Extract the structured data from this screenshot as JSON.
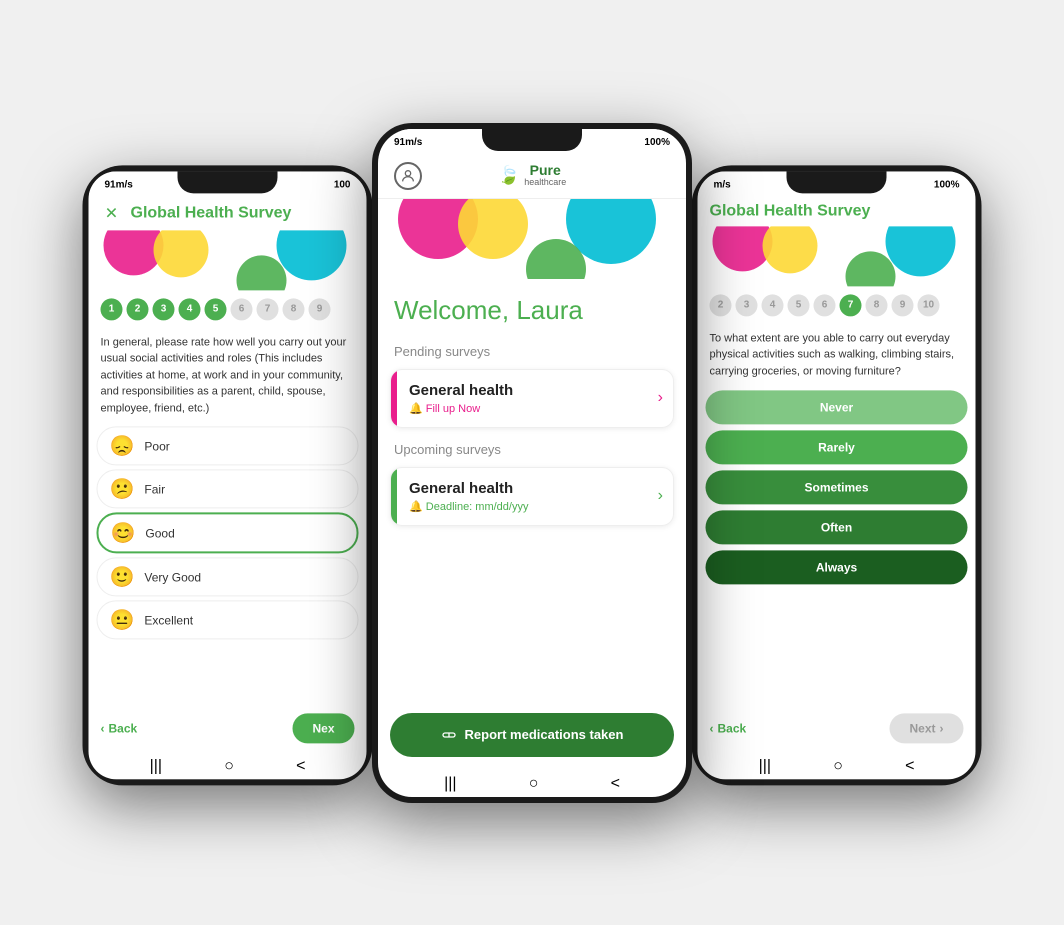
{
  "scene": {
    "bg_color": "#f5f5f5"
  },
  "center_phone": {
    "status": {
      "signal": "91m/s",
      "battery": "100%"
    },
    "header": {
      "profile_icon": "👤",
      "logo_pure": "Pure",
      "logo_healthcare": "healthcare",
      "logo_leaf": "🍃"
    },
    "welcome": "Welcome, Laura",
    "pending_label": "Pending surveys",
    "pending_card": {
      "title": "General health",
      "subtitle": "Fill up Now",
      "bell": "🔔"
    },
    "upcoming_label": "Upcoming surveys",
    "upcoming_card": {
      "title": "General health",
      "subtitle": "Deadline: mm/dd/yyy",
      "bell": "🔔"
    },
    "report_btn": "Report medications taken",
    "nav": {
      "back": "|||",
      "home": "○",
      "forward": "<"
    }
  },
  "left_phone": {
    "status": {
      "signal": "91m/s",
      "battery": "100"
    },
    "header": {
      "close": "✕",
      "title": "Global Health Survey"
    },
    "progress": [
      1,
      2,
      3,
      4,
      5,
      6,
      7,
      8,
      9
    ],
    "active_step": 5,
    "question": "In general, please rate how well you carry out your usual social activities and roles (This includes activities at home, at work and in your community, and responsibilities as a parent, child, spouse, employee, friend, etc.)",
    "options": [
      {
        "emoji": "😞",
        "label": "Poor"
      },
      {
        "emoji": "😕",
        "label": "Fair"
      },
      {
        "emoji": "😊",
        "label": "Good",
        "selected": true
      },
      {
        "emoji": "🙂",
        "label": "Very Good"
      },
      {
        "emoji": "😐",
        "label": "Excellent"
      }
    ],
    "back_btn": "Back",
    "next_btn": "Nex"
  },
  "right_phone": {
    "status": {
      "signal": "m/s",
      "battery": "100%"
    },
    "header": {
      "title": "Global Health Survey"
    },
    "progress": [
      2,
      3,
      4,
      5,
      6,
      7,
      8,
      9,
      10
    ],
    "active_step": 7,
    "question": "To what extent are you able to carry out everyday physical activities such as walking, climbing stairs, carrying groceries, or moving furniture?",
    "answers": [
      {
        "label": "Never",
        "class": "btn-light-green"
      },
      {
        "label": "Rarely",
        "class": "btn-med-green"
      },
      {
        "label": "Sometimes",
        "class": "btn-dark-green"
      },
      {
        "label": "Often",
        "class": "btn-darker-green"
      },
      {
        "label": "Always",
        "class": "btn-darkest-green"
      }
    ],
    "back_btn": "Back",
    "next_btn": "Next"
  }
}
